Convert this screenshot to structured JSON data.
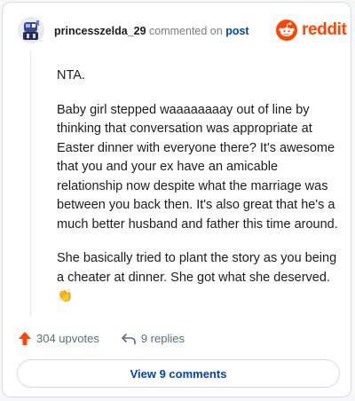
{
  "header": {
    "username": "princesszelda_29",
    "action_text": "commented on",
    "post_link": "post",
    "brand": "reddit"
  },
  "comment": {
    "paragraphs": [
      "NTA.",
      "Baby girl stepped waaaaaaaay out of line by thinking that conversation was appropriate at Easter dinner with everyone there? It's awesome that you and your ex have an amicable relationship now despite what the marriage was between you back then. It's also great that he's a much better husband and father this time around.",
      "She basically tried to plant the story as you being a cheater at dinner. She got what she deserved."
    ],
    "emoji": "👏"
  },
  "actions": {
    "upvotes": "304 upvotes",
    "replies": "9 replies"
  },
  "view_comments": "View 9 comments",
  "colors": {
    "brand": "#ff4500",
    "link": "#0045ac",
    "upvote": "#ff4500",
    "muted": "#576f76"
  },
  "icons": {
    "avatar": "avatar-icon",
    "brand_logo": "reddit-logo-icon",
    "upvote": "upvote-arrow-icon",
    "reply": "reply-arrow-icon",
    "clap": "clapping-hands-icon"
  }
}
